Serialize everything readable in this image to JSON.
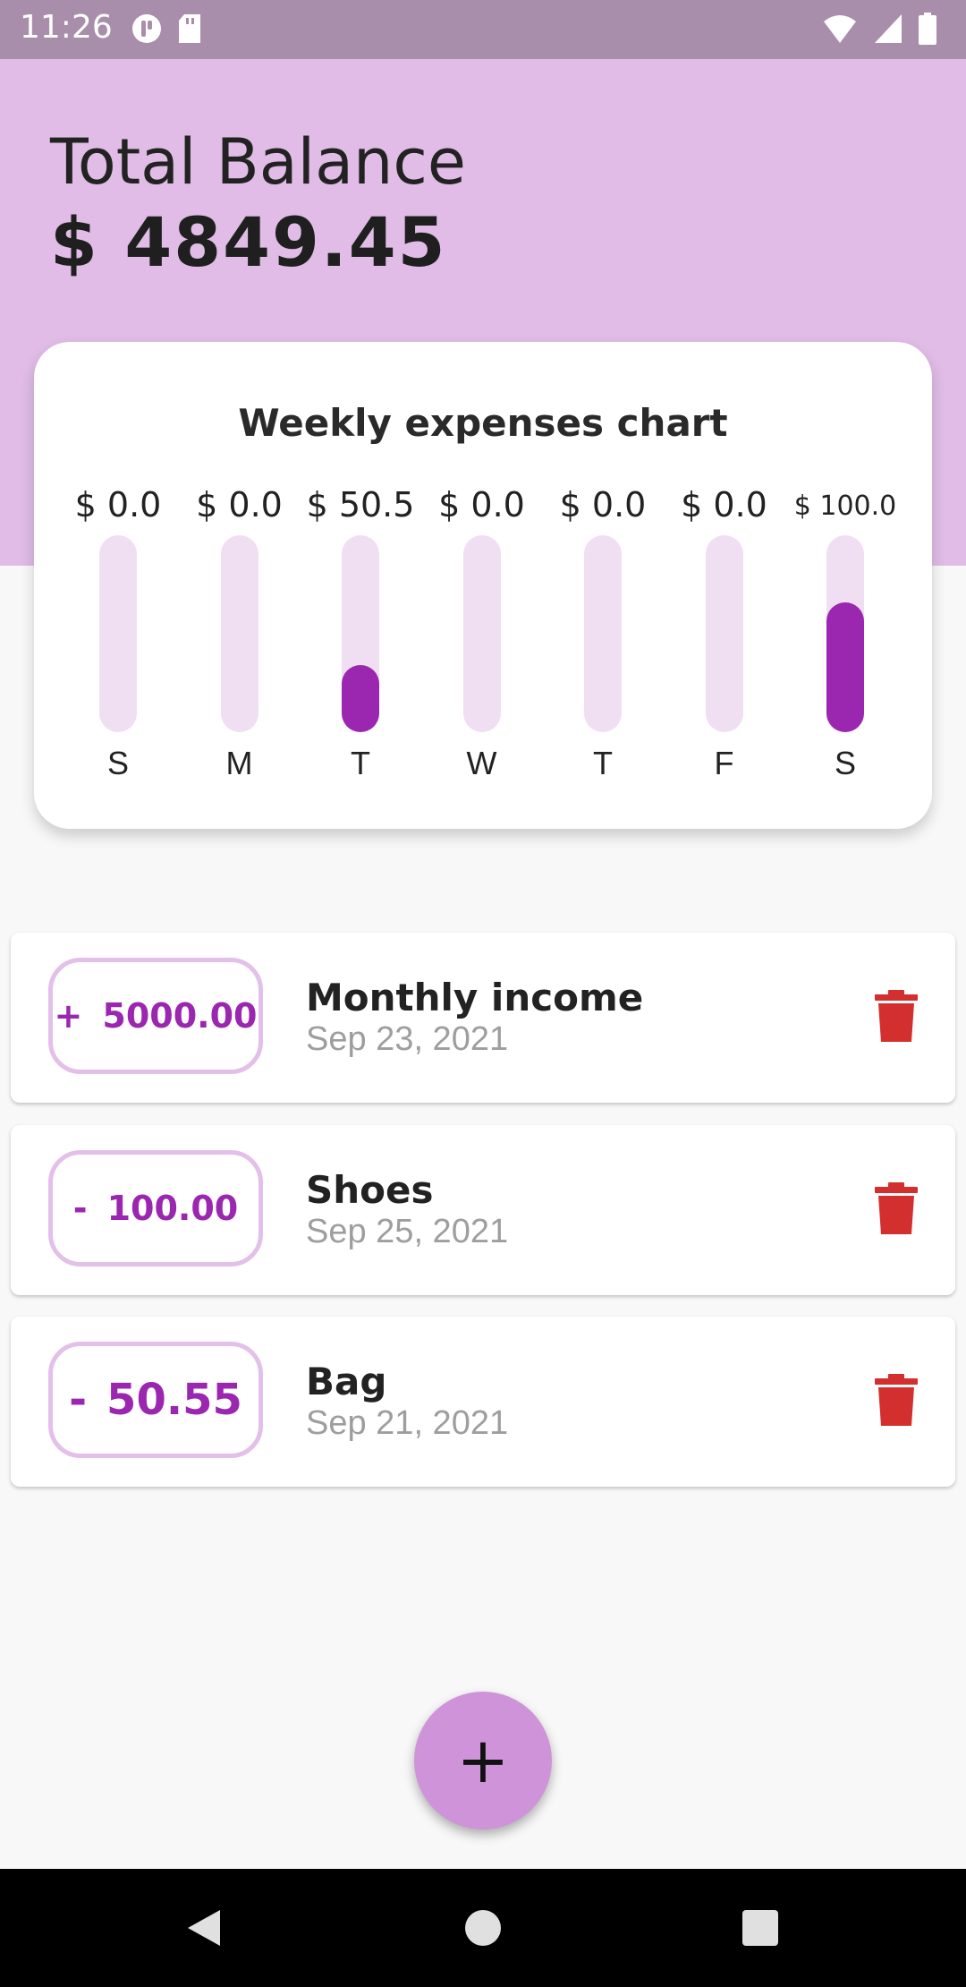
{
  "status": {
    "time": "11:26"
  },
  "header": {
    "title": "Total Balance",
    "balance": "$ 4849.45"
  },
  "chart_data": {
    "type": "bar",
    "title": "Weekly expenses chart",
    "categories": [
      "S",
      "M",
      "T",
      "W",
      "T",
      "F",
      "S"
    ],
    "value_labels": [
      "$ 0.0",
      "$ 0.0",
      "$ 50.5",
      "$ 0.0",
      "$ 0.0",
      "$ 0.0",
      "$ 100.0"
    ],
    "values": [
      0,
      0,
      50.55,
      0,
      0,
      0,
      100
    ],
    "fill_fractions": [
      0,
      0,
      0.34,
      0,
      0,
      0,
      0.66
    ],
    "colors": {
      "track": "#f0dff2",
      "fill": "#9b27b0"
    }
  },
  "transactions": [
    {
      "sign": "+",
      "amount": "5000.00",
      "title": "Monthly income",
      "date": "Sep 23, 2021"
    },
    {
      "sign": "-",
      "amount": "100.00",
      "title": "Shoes",
      "date": "Sep 25, 2021"
    },
    {
      "sign": "-",
      "amount": "50.55",
      "title": "Bag",
      "date": "Sep 21, 2021"
    }
  ],
  "fab": {
    "label": "+"
  },
  "icons": {
    "delete": "trash-icon",
    "add": "plus-icon",
    "wifi": "wifi-icon",
    "signal": "signal-icon",
    "battery": "battery-icon"
  }
}
